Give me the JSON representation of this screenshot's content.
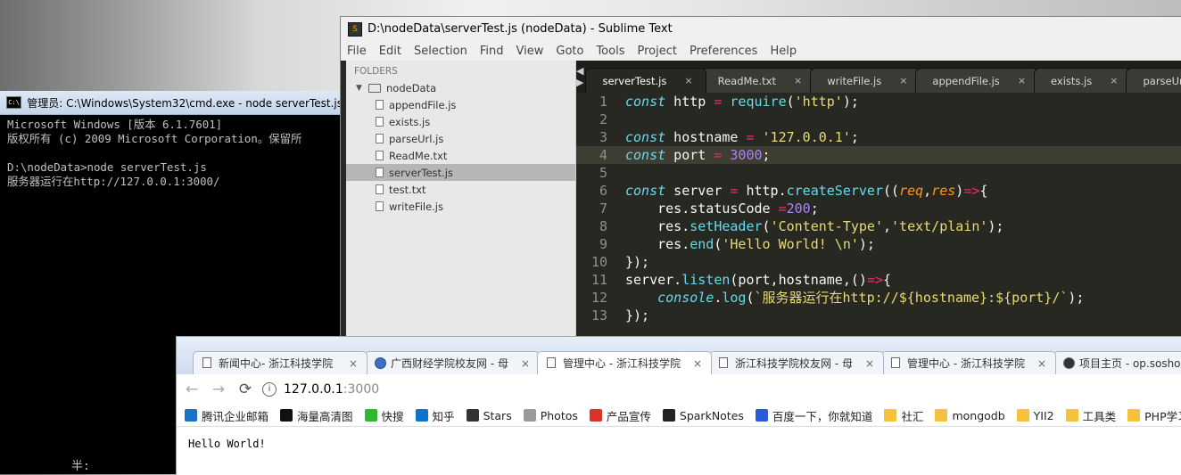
{
  "cmd": {
    "title": "管理员: C:\\Windows\\System32\\cmd.exe - node  serverTest.js",
    "lines": [
      "Microsoft Windows [版本 6.1.7601]",
      "版权所有 (c) 2009 Microsoft Corporation。保留所",
      "",
      "D:\\nodeData>node serverTest.js",
      "服务器运行在http://127.0.0.1:3000/"
    ],
    "footer": "半:"
  },
  "sublime": {
    "title": "D:\\nodeData\\serverTest.js (nodeData) - Sublime Text",
    "menu": [
      "File",
      "Edit",
      "Selection",
      "Find",
      "View",
      "Goto",
      "Tools",
      "Project",
      "Preferences",
      "Help"
    ],
    "sidebar": {
      "folders_label": "FOLDERS",
      "folder": "nodeData",
      "files": [
        "appendFile.js",
        "exists.js",
        "parseUrl.js",
        "ReadMe.txt",
        "serverTest.js",
        "test.txt",
        "writeFile.js"
      ],
      "selected": "serverTest.js"
    },
    "tabs": [
      {
        "label": "serverTest.js",
        "active": true
      },
      {
        "label": "ReadMe.txt"
      },
      {
        "label": "writeFile.js"
      },
      {
        "label": "appendFile.js"
      },
      {
        "label": "exists.js"
      },
      {
        "label": "parseUrl.js"
      }
    ],
    "current_line": 4,
    "code": [
      [
        [
          "k",
          "const"
        ],
        [
          "t",
          " http "
        ],
        [
          "o",
          "="
        ],
        [
          "t",
          " "
        ],
        [
          "f",
          "require"
        ],
        [
          "t",
          "("
        ],
        [
          "s",
          "'http'"
        ],
        [
          "t",
          ");"
        ]
      ],
      [],
      [
        [
          "k",
          "const"
        ],
        [
          "t",
          " hostname "
        ],
        [
          "o",
          "="
        ],
        [
          "t",
          " "
        ],
        [
          "s",
          "'127.0.0.1'"
        ],
        [
          "t",
          ";"
        ]
      ],
      [
        [
          "k",
          "const"
        ],
        [
          "t",
          " port "
        ],
        [
          "o",
          "="
        ],
        [
          "t",
          " "
        ],
        [
          "n",
          "3000"
        ],
        [
          "t",
          ";"
        ]
      ],
      [],
      [
        [
          "k",
          "const"
        ],
        [
          "t",
          " server "
        ],
        [
          "o",
          "="
        ],
        [
          "t",
          " http."
        ],
        [
          "f",
          "createServer"
        ],
        [
          "t",
          "(("
        ],
        [
          "p",
          "req"
        ],
        [
          "t",
          ","
        ],
        [
          "p",
          "res"
        ],
        [
          "t",
          ")"
        ],
        [
          "o",
          "=>"
        ],
        [
          "t",
          "{"
        ]
      ],
      [
        [
          "t",
          "    res.statusCode "
        ],
        [
          "o",
          "="
        ],
        [
          "n",
          "200"
        ],
        [
          "t",
          ";"
        ]
      ],
      [
        [
          "t",
          "    res."
        ],
        [
          "f",
          "setHeader"
        ],
        [
          "t",
          "("
        ],
        [
          "s",
          "'Content-Type'"
        ],
        [
          "t",
          ","
        ],
        [
          "s",
          "'text/plain'"
        ],
        [
          "t",
          ");"
        ]
      ],
      [
        [
          "t",
          "    res."
        ],
        [
          "f",
          "end"
        ],
        [
          "t",
          "("
        ],
        [
          "s",
          "'Hello World! \\n'"
        ],
        [
          "t",
          ");"
        ]
      ],
      [
        [
          "t",
          "});"
        ]
      ],
      [
        [
          "t",
          "server."
        ],
        [
          "f",
          "listen"
        ],
        [
          "t",
          "(port,hostname,()"
        ],
        [
          "o",
          "=>"
        ],
        [
          "t",
          "{"
        ]
      ],
      [
        [
          "t",
          "    "
        ],
        [
          "k",
          "console"
        ],
        [
          "t",
          "."
        ],
        [
          "f",
          "log"
        ],
        [
          "t",
          "("
        ],
        [
          "s",
          "`服务器运行在http://${hostname}:${port}/`"
        ],
        [
          "t",
          ");"
        ]
      ],
      [
        [
          "t",
          "});"
        ]
      ]
    ]
  },
  "chrome": {
    "tabs": [
      {
        "label": "新闻中心- 浙江科技学院",
        "icon": "page"
      },
      {
        "label": "广西财经学院校友网 - 母",
        "icon": "globe"
      },
      {
        "label": "管理中心 - 浙江科技学院",
        "icon": "page",
        "active": true
      },
      {
        "label": "浙江科技学院校友网 - 母",
        "icon": "page"
      },
      {
        "label": "管理中心 - 浙江科技学院",
        "icon": "page"
      },
      {
        "label": "项目主页 - op.sosho",
        "icon": "github"
      }
    ],
    "url_host": "127.0.0.1",
    "url_port": ":3000",
    "bookmarks": [
      {
        "label": "腾讯企业邮箱",
        "icon": "qq-icon",
        "color": "#1a73c7"
      },
      {
        "label": "海量高清图",
        "icon": "camera-icon",
        "color": "#111111"
      },
      {
        "label": "快搜",
        "icon": "q-icon",
        "color": "#2eb82e"
      },
      {
        "label": "知乎",
        "icon": "zhihu-icon",
        "color": "#0e73c6"
      },
      {
        "label": "Stars",
        "icon": "github-icon",
        "color": "#333333"
      },
      {
        "label": "Photos",
        "icon": "photos-icon",
        "color": "#999999"
      },
      {
        "label": "产品宣传",
        "icon": "red-icon",
        "color": "#d9342b"
      },
      {
        "label": "SparkNotes",
        "icon": "spark-icon",
        "color": "#222222"
      },
      {
        "label": "百度一下，你就知道",
        "icon": "baidu-icon",
        "color": "#2a5bd7"
      },
      {
        "label": "社汇",
        "icon": "folder-icon",
        "color": "#f5c33b"
      },
      {
        "label": "mongodb",
        "icon": "folder-icon",
        "color": "#f5c33b"
      },
      {
        "label": "YII2",
        "icon": "folder-icon",
        "color": "#f5c33b"
      },
      {
        "label": "工具类",
        "icon": "folder-icon",
        "color": "#f5c33b"
      },
      {
        "label": "PHP学习",
        "icon": "folder-icon",
        "color": "#f5c33b"
      }
    ],
    "page_text": "Hello World!"
  }
}
